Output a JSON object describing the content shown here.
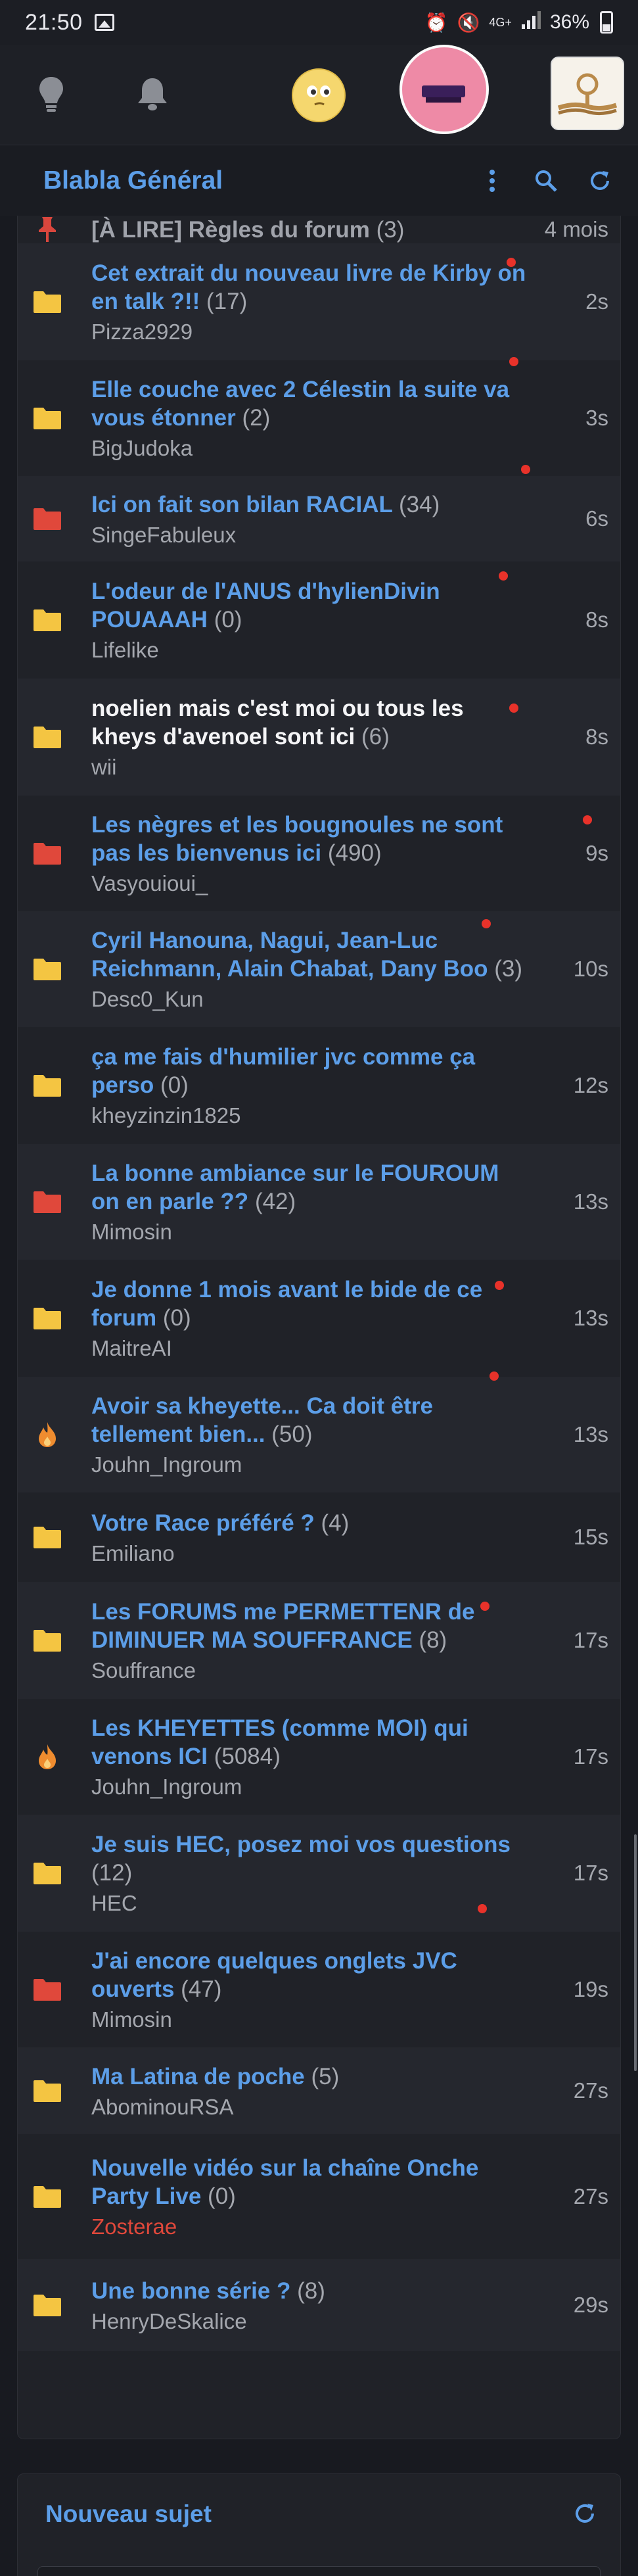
{
  "status_bar": {
    "time": "21:50",
    "network": "4G+",
    "battery": "36%",
    "icons": [
      "image-icon",
      "alarm-icon",
      "mute-icon",
      "signal-icon",
      "battery-icon"
    ]
  },
  "nav": {
    "icons": [
      "lightbulb-icon",
      "bell-icon",
      "smiley-avatar",
      "pink-avatar",
      "rope-avatar"
    ]
  },
  "forum": {
    "title": "Blabla Général",
    "actions": [
      "more-vertical-icon",
      "search-icon",
      "refresh-icon"
    ]
  },
  "colors": {
    "accent_blue": "#5c9ee8",
    "folder_yellow": "#f4c542",
    "folder_red": "#e0483b",
    "fire_orange": "#ef8c2f",
    "pin_red": "#d9463d",
    "background": "#181a20"
  },
  "topics": [
    {
      "icon": "pin",
      "title": "[À LIRE] Règles du forum",
      "count": "(3)",
      "author": "",
      "time": "4 mois",
      "style": "gray"
    },
    {
      "icon": "folder-yellow",
      "title": "Cet extrait du nouveau livre de Kirby on en talk ?!!",
      "count": "(17)",
      "author": "Pizza2929",
      "time": "2s",
      "style": "blue"
    },
    {
      "icon": "folder-yellow",
      "title": "Elle couche avec 2 Célestin la suite va vous étonner",
      "count": "(2)",
      "author": "BigJudoka",
      "time": "3s",
      "style": "blue"
    },
    {
      "icon": "folder-red",
      "title": "Ici on fait son bilan RACIAL",
      "count": "(34)",
      "author": "SingeFabuleux",
      "time": "6s",
      "style": "blue"
    },
    {
      "icon": "folder-yellow",
      "title": "L'odeur de l'ANUS d'hylienDivin POUAAAH",
      "count": "(0)",
      "author": "Lifelike",
      "time": "8s",
      "style": "blue"
    },
    {
      "icon": "folder-yellow",
      "title": "noelien mais c'est moi ou tous les kheys d'avenoel sont ici",
      "count": "(6)",
      "author": "wii",
      "time": "8s",
      "style": "white"
    },
    {
      "icon": "folder-red",
      "title": "Les nègres et les bougnoules ne sont pas les bienvenus ici",
      "count": "(490)",
      "author": "Vasyouioui_",
      "time": "9s",
      "style": "blue"
    },
    {
      "icon": "folder-yellow",
      "title": "Cyril Hanouna, Nagui, Jean-Luc Reichmann, Alain Chabat, Dany Boo",
      "count": "(3)",
      "author": "Desc0_Kun",
      "time": "10s",
      "style": "blue"
    },
    {
      "icon": "folder-yellow",
      "title": "ça me fais d'humilier jvc comme ça perso",
      "count": "(0)",
      "author": "kheyzinzin1825",
      "time": "12s",
      "style": "blue"
    },
    {
      "icon": "folder-red",
      "title": "La bonne ambiance sur le FOUROUM on en parle ??",
      "count": "(42)",
      "author": "Mimosin",
      "time": "13s",
      "style": "blue"
    },
    {
      "icon": "folder-yellow",
      "title": "Je donne 1 mois avant le bide de ce forum",
      "count": "(0)",
      "author": "MaitreAI",
      "time": "13s",
      "style": "blue"
    },
    {
      "icon": "fire",
      "title": "Avoir sa kheyette... Ca doit être tellement bien...",
      "count": "(50)",
      "author": "Jouhn_Ingroum",
      "time": "13s",
      "style": "blue"
    },
    {
      "icon": "folder-yellow",
      "title": "Votre Race préféré ?",
      "count": "(4)",
      "author": "Emiliano",
      "time": "15s",
      "style": "blue"
    },
    {
      "icon": "folder-yellow",
      "title": "Les FORUMS me PERMETTENR de DIMINUER MA SOUFFRANCE",
      "count": "(8)",
      "author": "Souffrance",
      "time": "17s",
      "style": "blue"
    },
    {
      "icon": "fire",
      "title": "Les KHEYETTES (comme MOI) qui venons ICI",
      "count": "(5084)",
      "author": "Jouhn_Ingroum",
      "time": "17s",
      "style": "blue"
    },
    {
      "icon": "folder-yellow",
      "title": "Je suis HEC, posez moi vos questions",
      "count": "(12)",
      "author": "HEC",
      "time": "17s",
      "style": "blue"
    },
    {
      "icon": "folder-red",
      "title": "J'ai encore quelques onglets JVC ouverts",
      "count": "(47)",
      "author": "Mimosin",
      "time": "19s",
      "style": "blue"
    },
    {
      "icon": "folder-yellow",
      "title": "Ma Latina de poche",
      "count": "(5)",
      "author": "AbominouRSA",
      "time": "27s",
      "style": "blue"
    },
    {
      "icon": "folder-yellow",
      "title": "Nouvelle vidéo sur la chaîne Onche Party Live",
      "count": "(0)",
      "author": "Zosterae",
      "time": "27s",
      "style": "blue",
      "author_style": "red"
    },
    {
      "icon": "folder-yellow",
      "title": "Une bonne série ?",
      "count": "(8)",
      "author": "HenryDeSkalice",
      "time": "29s",
      "style": "blue"
    }
  ],
  "pager": {
    "prev": "‹",
    "next": "›"
  },
  "new_topic": {
    "title": "Nouveau sujet"
  }
}
